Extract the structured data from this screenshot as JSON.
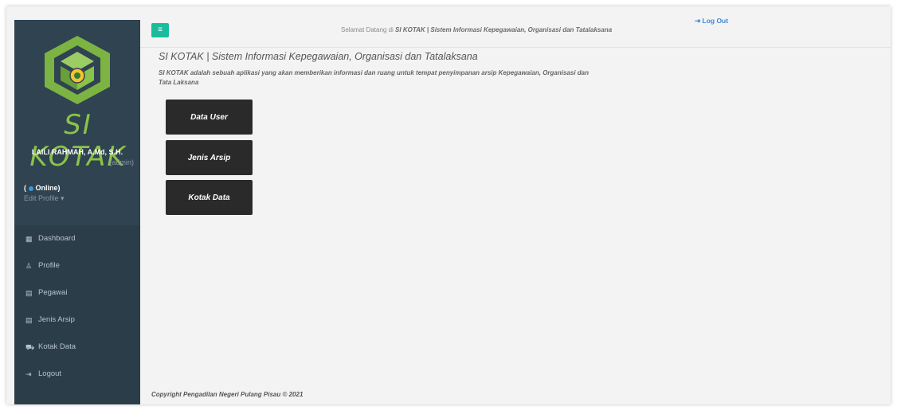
{
  "header": {
    "welcome_prefix": "Selamat Datang di ",
    "welcome_app": "SI KOTAK | Sistem Informasi Kepegawaian, Organisasi dan Tatalaksana",
    "logout_label": "Log Out"
  },
  "sidebar": {
    "logo_text": "SI KOTAK",
    "user_name": "LAILI RAHMAH, A.Md, S.H.",
    "user_role": "(admin)",
    "status_open": "(",
    "status_label": "Online)",
    "edit_profile": "Edit Profile",
    "items": [
      {
        "label": "Dashboard",
        "icon": "grid-icon"
      },
      {
        "label": "Profile",
        "icon": "user-icon"
      },
      {
        "label": "Pegawai",
        "icon": "table-icon"
      },
      {
        "label": "Jenis Arsip",
        "icon": "table-icon"
      },
      {
        "label": "Kotak Data",
        "icon": "cart-icon"
      },
      {
        "label": "Logout",
        "icon": "signout-icon"
      }
    ]
  },
  "main": {
    "title": "SI KOTAK | Sistem Informasi Kepegawaian, Organisasi dan Tatalaksana",
    "description": "SI KOTAK adalah sebuah aplikasi yang akan memberikan informasi dan ruang untuk tempat penyimpanan arsip Kepegawaian, Organisasi dan Tata Laksana",
    "tiles": [
      "Data User",
      "Jenis Arsip",
      "Kotak Data"
    ]
  },
  "footer": {
    "copyright": "Copyright Pengadilan Negeri Pulang Pisau © 2021"
  },
  "colors": {
    "sidebar_bg": "#2c3d4a",
    "accent_green": "#8bc34a",
    "toggle_button": "#1abc9c",
    "tile_bg": "#2a2a2a",
    "online_dot": "#3a9ad9"
  }
}
